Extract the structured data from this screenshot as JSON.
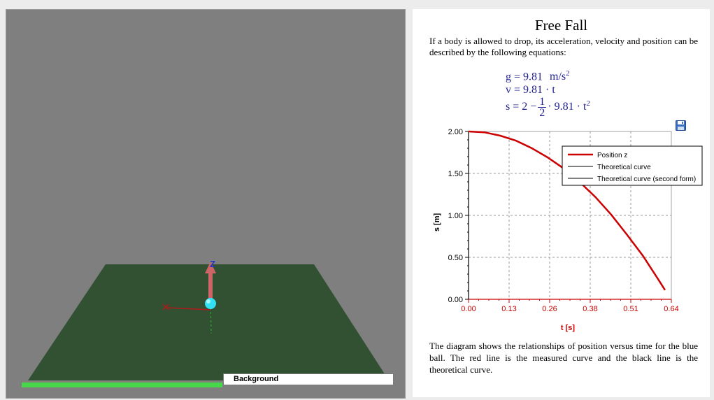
{
  "viewport": {
    "axis_labels": {
      "x": "X",
      "z": "Z"
    },
    "layer_field_value": "Background",
    "progress": 0.5,
    "colors": {
      "floor": "#325032",
      "ball": "#33e1f4",
      "z_arrow": "#cc6666",
      "x_axis": "#b21a1a",
      "y_axis": "#2a9a2a",
      "z_label": "#2233cc",
      "background": "#7f7f7f"
    }
  },
  "document": {
    "title": "Free Fall",
    "intro": "If a body is allowed to drop, its acceleration, velocity and position can be described by the following equations:",
    "equations": {
      "g_lhs": "g = ",
      "g_value": "9.81",
      "g_unit": "m/s",
      "g_exp": "2",
      "v": "v = 9.81 · t",
      "s_lhs": "s = 2 −",
      "s_num": "1",
      "s_den": "2",
      "s_rhs": "· 9.81 · t",
      "s_exp": "2"
    },
    "outro": "The diagram shows the relationships of position versus time for the blue ball. The red line is the measured curve and the black line is the theoretical curve.",
    "save_icon": "floppy-disk-icon"
  },
  "chart_data": {
    "type": "line",
    "xlabel": "t [s]",
    "ylabel": "s [m]",
    "xlim": [
      0.0,
      0.64
    ],
    "ylim": [
      0.0,
      2.0
    ],
    "xticks": [
      "0.00",
      "0.13",
      "0.26",
      "0.38",
      "0.51",
      "0.64"
    ],
    "xtick_values": [
      0.0,
      0.128,
      0.256,
      0.384,
      0.512,
      0.64
    ],
    "yticks": [
      "0.00",
      "0.50",
      "1.00",
      "1.50",
      "2.00"
    ],
    "ytick_values": [
      0.0,
      0.5,
      1.0,
      1.5,
      2.0
    ],
    "grid": true,
    "legend_position": "top-right",
    "series": [
      {
        "name": "Position z",
        "color": "#cc0000",
        "x": [
          0.0,
          0.05,
          0.1,
          0.15,
          0.2,
          0.25,
          0.3,
          0.35,
          0.4,
          0.45,
          0.5,
          0.55,
          0.6,
          0.62
        ],
        "y": [
          2.0,
          1.99,
          1.95,
          1.89,
          1.8,
          1.69,
          1.56,
          1.4,
          1.22,
          1.01,
          0.77,
          0.52,
          0.23,
          0.11
        ]
      },
      {
        "name": "Theoretical curve",
        "color": "#000000",
        "x": [],
        "y": []
      },
      {
        "name": "Theoretical curve (second form)",
        "color": "#000000",
        "x": [],
        "y": []
      }
    ]
  }
}
